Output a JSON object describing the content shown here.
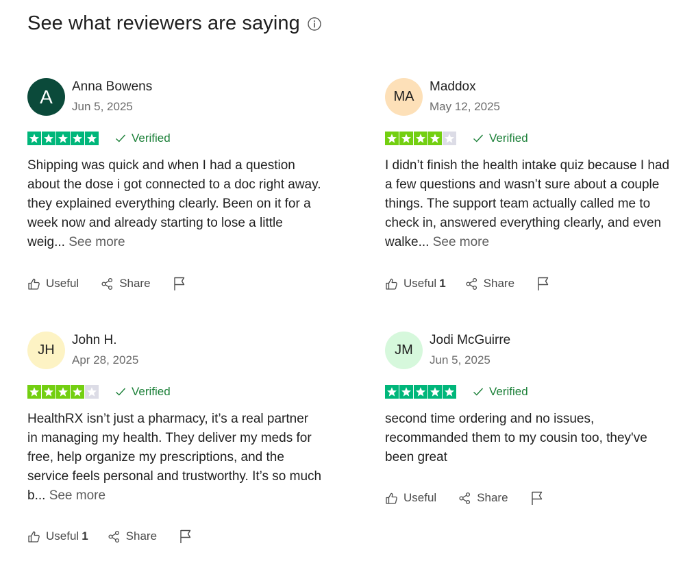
{
  "header": {
    "title": "See what reviewers are saying",
    "info_icon": "info-circle-icon"
  },
  "colors": {
    "star_green": "#00b67a",
    "star_fill_4": "#73cf11",
    "star_empty": "#dcdce6",
    "verified_green": "#1a7f37"
  },
  "reviews": [
    {
      "initials": "A",
      "avatar_color": "#0b4a3a",
      "name": "Anna Bowens",
      "date": "Jun 5, 2025",
      "rating": 5,
      "verified_label": "Verified",
      "text": "Shipping was quick and when I had a question about the dose i got connected to a doc right away. they explained everything clearly. Been on it for a week now and already starting to lose a little weig...",
      "see_more": "See more",
      "useful_label": "Useful",
      "useful_count": "",
      "share_label": "Share"
    },
    {
      "initials": "MA",
      "avatar_color": "#fde0b8",
      "name": "Maddox",
      "date": "May 12, 2025",
      "rating": 4,
      "verified_label": "Verified",
      "text": "I didn’t finish the health intake quiz because I had a few questions and wasn’t sure about a couple things. The support team actually called me to check in, answered everything clearly, and even walke...",
      "see_more": "See more",
      "useful_label": "Useful",
      "useful_count": "1",
      "share_label": "Share"
    },
    {
      "initials": "JH",
      "avatar_color": "#fdf3c4",
      "name": "John H.",
      "date": "Apr 28, 2025",
      "rating": 4,
      "verified_label": "Verified",
      "text": "HealthRX isn’t just a pharmacy, it’s a real partner in managing my health. They deliver my meds for free, help organize my prescriptions, and the service feels personal and trustworthy. It’s so much b...",
      "see_more": "See more",
      "useful_label": "Useful",
      "useful_count": "1",
      "share_label": "Share"
    },
    {
      "initials": "JM",
      "avatar_color": "#d6f8dc",
      "name": "Jodi McGuirre",
      "date": "Jun 5, 2025",
      "rating": 5,
      "verified_label": "Verified",
      "text": "second time ordering and no issues, recommanded them to my cousin too, they've been great",
      "see_more": "",
      "useful_label": "Useful",
      "useful_count": "",
      "share_label": "Share"
    }
  ]
}
